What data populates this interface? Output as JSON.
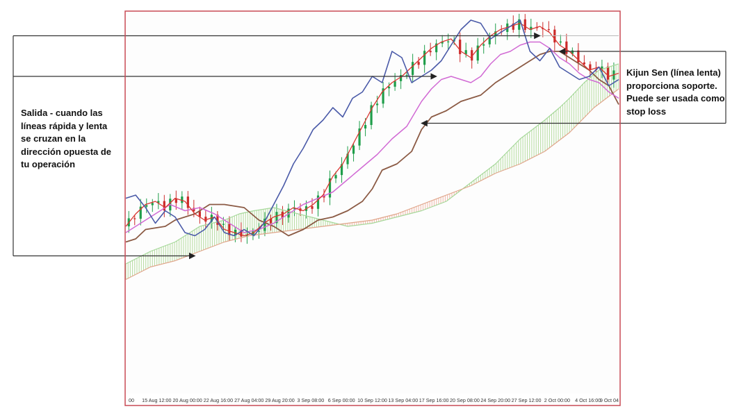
{
  "annotations": {
    "left": "Salida - cuando las\nlíneas rápida y lenta\nse cruzan en la\ndirección opuesta de\ntu operación",
    "right": "Kijun Sen (línea lenta)\nproporciona soporte.\nPuede ser usada como\nstop loss"
  },
  "chart_data": {
    "type": "line",
    "title": "",
    "xlabel": "",
    "ylabel": "",
    "x_tick_labels": [
      "00",
      "15 Aug 12:00",
      "20 Aug 00:00",
      "22 Aug 16:00",
      "27 Aug 04:00",
      "29 Aug 20:00",
      "3 Sep 08:00",
      "6 Sep 00:00",
      "10 Sep 12:00",
      "13 Sep 04:00",
      "17 Sep 16:00",
      "20 Sep 08:00",
      "24 Sep 20:00",
      "27 Sep 12:00",
      "2 Oct 00:00",
      "4 Oct 16:00",
      "9 Oct 04"
    ],
    "grid": false,
    "ylim": [
      0,
      100
    ],
    "colors": {
      "frame": "#c84a55",
      "chikou": "#4a5aa8",
      "kijun": "#8b5a44",
      "tenkan": "#d16ad4",
      "price": "#d9342f",
      "cloud_bull_fill": "#b6dca0",
      "cloud_bear_fill": "#efb8a8",
      "span_a": "#a6d89a",
      "span_b": "#e0a58a",
      "candle_up": "#1f9e4a",
      "candle_down": "#cc2a2a"
    },
    "series": [
      {
        "key": "kijun",
        "x": [
          0,
          2,
          4,
          8,
          10,
          14,
          17,
          20,
          24,
          27,
          30,
          33,
          36,
          39,
          42,
          45,
          48,
          50,
          52,
          55,
          58,
          60,
          62,
          65,
          68,
          70,
          72,
          75,
          77,
          80,
          82,
          84,
          86,
          88,
          90,
          92,
          94,
          96,
          98,
          100
        ],
        "values": [
          27,
          28,
          31,
          32,
          34,
          36,
          39,
          39,
          38,
          34,
          32,
          29,
          31,
          34,
          35,
          37,
          40,
          44,
          50,
          52,
          56,
          63,
          67,
          69,
          72,
          73,
          74,
          78,
          80,
          83,
          85,
          87,
          88,
          88,
          86,
          84,
          82,
          79,
          77,
          71
        ]
      },
      {
        "key": "tenkan",
        "x": [
          0,
          3,
          6,
          9,
          12,
          15,
          18,
          21,
          24,
          27,
          30,
          33,
          36,
          39,
          42,
          45,
          48,
          51,
          54,
          57,
          60,
          62,
          64,
          66,
          68,
          70,
          72,
          74,
          76,
          78,
          80,
          82,
          84,
          86,
          88,
          90,
          92,
          94,
          96,
          98,
          100
        ],
        "values": [
          30,
          33,
          36,
          39,
          37,
          38,
          36,
          33,
          30,
          31,
          33,
          36,
          39,
          41,
          43,
          47,
          51,
          55,
          60,
          64,
          72,
          76,
          79,
          80,
          79,
          78,
          80,
          84,
          87,
          88,
          90,
          91,
          91,
          89,
          86,
          84,
          81,
          79,
          78,
          75,
          73
        ]
      },
      {
        "key": "chikou",
        "x": [
          0,
          2,
          4,
          6,
          8,
          10,
          12,
          14,
          16,
          18,
          20,
          22,
          24,
          26,
          28,
          30,
          32,
          34,
          36,
          38,
          40,
          42,
          44,
          46,
          48,
          50,
          52,
          54,
          56,
          58,
          60,
          62,
          64,
          66,
          68,
          70,
          72,
          74,
          76,
          78,
          80,
          82,
          84,
          86,
          88,
          90,
          92,
          94,
          96,
          98,
          100
        ],
        "values": [
          41,
          42,
          38,
          33,
          37,
          35,
          30,
          29,
          31,
          35,
          30,
          29,
          31,
          29,
          33,
          39,
          45,
          52,
          57,
          63,
          66,
          70,
          67,
          73,
          75,
          80,
          78,
          88,
          86,
          78,
          80,
          82,
          85,
          90,
          95,
          98,
          97,
          92,
          94,
          96,
          98,
          88,
          85,
          89,
          83,
          81,
          79,
          80,
          83,
          77,
          79
        ]
      },
      {
        "key": "price",
        "x": [
          0,
          2,
          4,
          6,
          8,
          10,
          12,
          14,
          16,
          18,
          20,
          22,
          24,
          26,
          28,
          30,
          32,
          34,
          36,
          38,
          40,
          42,
          44,
          46,
          48,
          50,
          52,
          54,
          56,
          58,
          60,
          62,
          64,
          66,
          68,
          70,
          72,
          74,
          76,
          78,
          80,
          82,
          84,
          86,
          88,
          90,
          92,
          94,
          96,
          98,
          100
        ],
        "values": [
          32,
          36,
          39,
          40,
          38,
          41,
          40,
          36,
          34,
          35,
          31,
          30,
          29,
          30,
          33,
          35,
          36,
          38,
          37,
          39,
          42,
          48,
          52,
          58,
          64,
          70,
          75,
          78,
          80,
          83,
          86,
          89,
          91,
          92,
          88,
          86,
          90,
          93,
          95,
          96,
          97,
          95,
          96,
          94,
          90,
          88,
          85,
          82,
          83,
          80,
          81
        ]
      },
      {
        "key": "span_a",
        "x": [
          0,
          5,
          10,
          15,
          20,
          23,
          26,
          30,
          35,
          40,
          45,
          50,
          55,
          60,
          65,
          70,
          75,
          80,
          85,
          88,
          90,
          93,
          96,
          100
        ],
        "values": [
          20,
          24,
          27,
          32,
          34,
          36,
          37,
          38,
          36,
          34,
          32,
          33,
          35,
          37,
          40,
          46,
          52,
          60,
          66,
          70,
          73,
          78,
          82,
          84
        ]
      },
      {
        "key": "span_b",
        "x": [
          0,
          5,
          10,
          15,
          20,
          25,
          30,
          35,
          40,
          45,
          50,
          55,
          60,
          65,
          70,
          75,
          80,
          85,
          90,
          95,
          100
        ],
        "values": [
          15,
          19,
          21,
          24,
          27,
          29,
          30,
          31,
          32,
          33,
          34,
          36,
          39,
          42,
          45,
          49,
          52,
          56,
          62,
          70,
          76
        ]
      }
    ],
    "reference_line": {
      "y": 93
    },
    "callouts": [
      {
        "label": "left",
        "arrows": [
          {
            "y": 93,
            "x_end": 84
          },
          {
            "y": 80,
            "x_end": 63
          },
          {
            "y": 37,
            "x_end": 14
          }
        ]
      },
      {
        "label": "right",
        "arrows": [
          {
            "y": 88,
            "x_end": 88
          },
          {
            "y": 65,
            "x_end": 60
          }
        ]
      }
    ]
  }
}
